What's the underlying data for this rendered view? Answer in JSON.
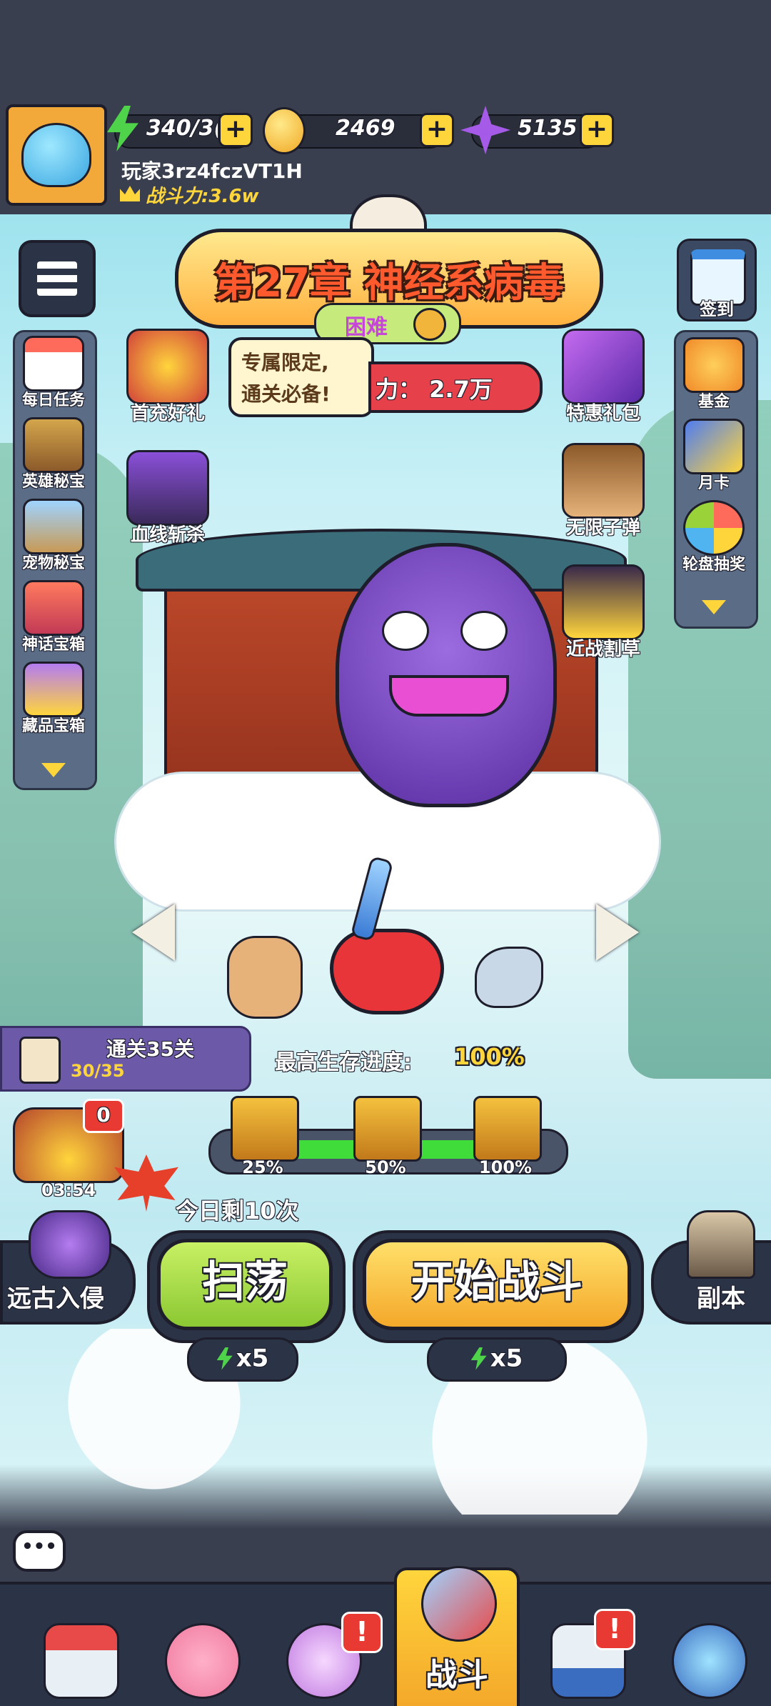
{
  "player": {
    "energy": "340/3(",
    "coins": "2469",
    "gems": "5135",
    "name": "玩家3rz4fczVT1H",
    "power_label": "战斗力:3.6w"
  },
  "chapter": {
    "title": "第27章 神经系病毒",
    "difficulty": "困难",
    "recommended_power": "力： 2.7万",
    "promo_bubble_line1": "专属限定,",
    "promo_bubble_line2": "通关必备!"
  },
  "left_sidebar": [
    {
      "label": "每日任务",
      "icon": "daily-tasks-icon"
    },
    {
      "label": "英雄秘宝",
      "icon": "hero-treasure-icon"
    },
    {
      "label": "宠物秘宝",
      "icon": "pet-treasure-icon"
    },
    {
      "label": "神话宝箱",
      "icon": "myth-chest-icon"
    },
    {
      "label": "藏品宝箱",
      "icon": "collection-chest-icon"
    }
  ],
  "right_sidebar": [
    {
      "label": "基金",
      "icon": "fund-icon"
    },
    {
      "label": "月卡",
      "icon": "monthly-card-icon"
    },
    {
      "label": "轮盘抽奖",
      "icon": "roulette-icon"
    }
  ],
  "top_right_button": {
    "label": "签到",
    "icon": "calendar-icon"
  },
  "promos_left": [
    {
      "label": "首充好礼",
      "icon": "first-charge-gift-icon"
    },
    {
      "label": "血线斩杀",
      "icon": "bloodline-slash-icon"
    }
  ],
  "promos_right": [
    {
      "label": "特惠礼包",
      "icon": "special-pack-icon"
    },
    {
      "label": "无限子弹",
      "icon": "infinite-bullets-icon"
    },
    {
      "label": "近战割草",
      "icon": "melee-mowing-icon"
    }
  ],
  "stage_progress": {
    "title": "通关35关",
    "count": "30/35",
    "best_survival_label": "最高生存进度:",
    "best_survival_value": "100%",
    "fill_fraction": 1.0,
    "chest_labels": [
      "25%",
      "50%",
      "100%"
    ]
  },
  "timer_reward": {
    "count": "0",
    "time": "03:54"
  },
  "daily_remaining": "今日剩10次",
  "buttons": {
    "sweep_label": "扫荡",
    "sweep_cost": "x5",
    "start_label": "开始战斗",
    "start_cost": "x5",
    "ancient_invasion": "远古入侵",
    "dungeon": "副本"
  },
  "bottom_nav": [
    {
      "name": "shop",
      "icon": "shop-icon",
      "label": ""
    },
    {
      "name": "brain",
      "icon": "brain-nurse-icon",
      "label": ""
    },
    {
      "name": "egg",
      "icon": "monster-egg-icon",
      "label": "",
      "badge": "!"
    },
    {
      "name": "battle",
      "icon": "syringe-battle-icon",
      "label": "战斗",
      "active": true
    },
    {
      "name": "medkit",
      "icon": "medkit-icon",
      "label": "",
      "badge": "!"
    },
    {
      "name": "rank",
      "icon": "rank-emblem-icon",
      "label": ""
    }
  ],
  "colors": {
    "accent_yellow": "#ffd53c",
    "green_button": "#9ad23a",
    "orange_button": "#f8c23f",
    "dark_panel": "#2b3446",
    "badge_red": "#e83a33"
  }
}
